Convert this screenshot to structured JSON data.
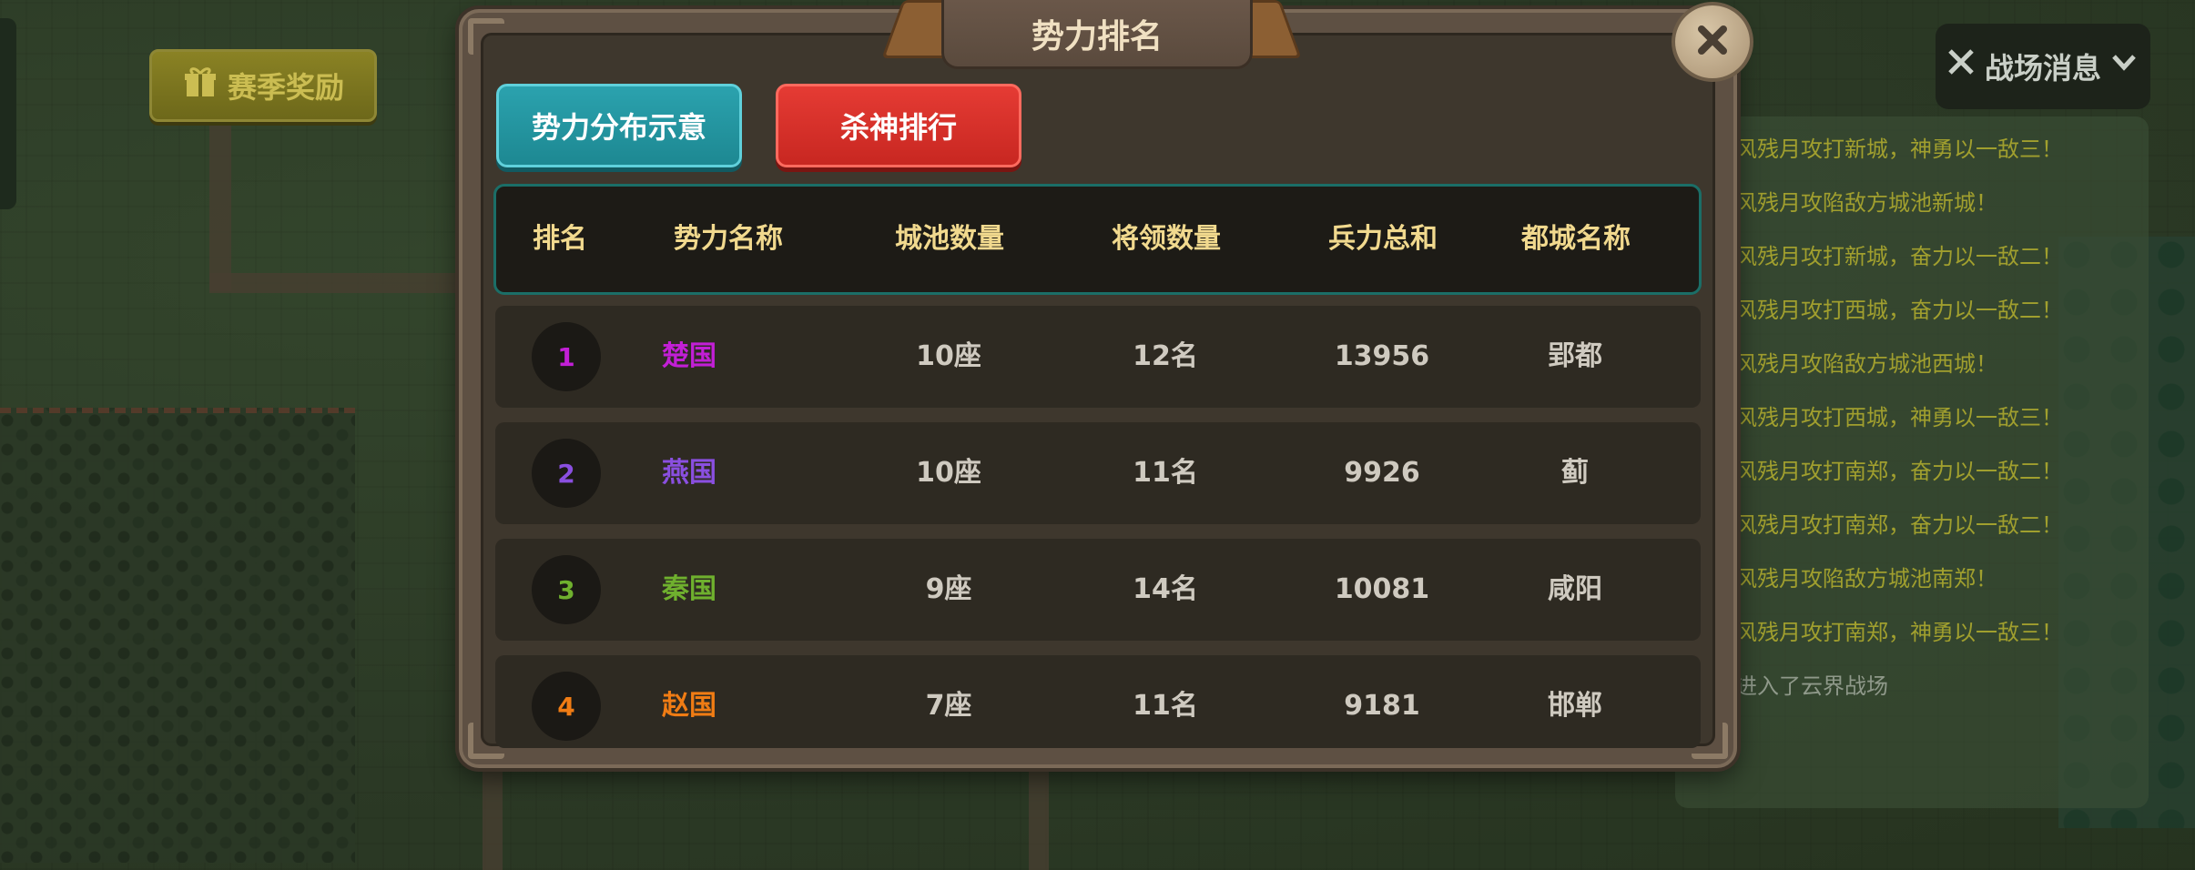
{
  "season_reward": {
    "label": "赛季奖励",
    "icon": "gift-icon"
  },
  "battle_messages": {
    "button_label": "战场消息",
    "lines": [
      "风残月攻打新城，神勇以一敌三！",
      "风残月攻陷敌方城池新城！",
      "风残月攻打新城，奋力以一敌二！",
      "风残月攻打西城，奋力以一敌二！",
      "风残月攻陷敌方城池西城！",
      "风残月攻打西城，神勇以一敌三！",
      "风残月攻打南郑，奋力以一敌二！",
      "风残月攻打南郑，奋力以一敌二！",
      "风残月攻陷敌方城池南郑！",
      "风残月攻打南郑，神勇以一敌三！",
      "进入了云界战场"
    ]
  },
  "dialog": {
    "title": "势力排名",
    "tabs": [
      {
        "label": "势力分布示意",
        "color": "#2ba2ae"
      },
      {
        "label": "杀神排行",
        "color": "#e53b34"
      }
    ],
    "columns": [
      "排名",
      "势力名称",
      "城池数量",
      "将领数量",
      "兵力总和",
      "都城名称"
    ],
    "rows": [
      {
        "rank": "1",
        "name": "楚国",
        "color": "#c21fd6",
        "cities": "10座",
        "generals": "12名",
        "troops": "13956",
        "capital": "郢都"
      },
      {
        "rank": "2",
        "name": "燕国",
        "color": "#8a4fe0",
        "cities": "10座",
        "generals": "11名",
        "troops": "9926",
        "capital": "蓟"
      },
      {
        "rank": "3",
        "name": "秦国",
        "color": "#6fb02e",
        "cities": "9座",
        "generals": "14名",
        "troops": "10081",
        "capital": "咸阳"
      },
      {
        "rank": "4",
        "name": "赵国",
        "color": "#f07c14",
        "cities": "7座",
        "generals": "11名",
        "troops": "9181",
        "capital": "邯郸"
      }
    ]
  }
}
